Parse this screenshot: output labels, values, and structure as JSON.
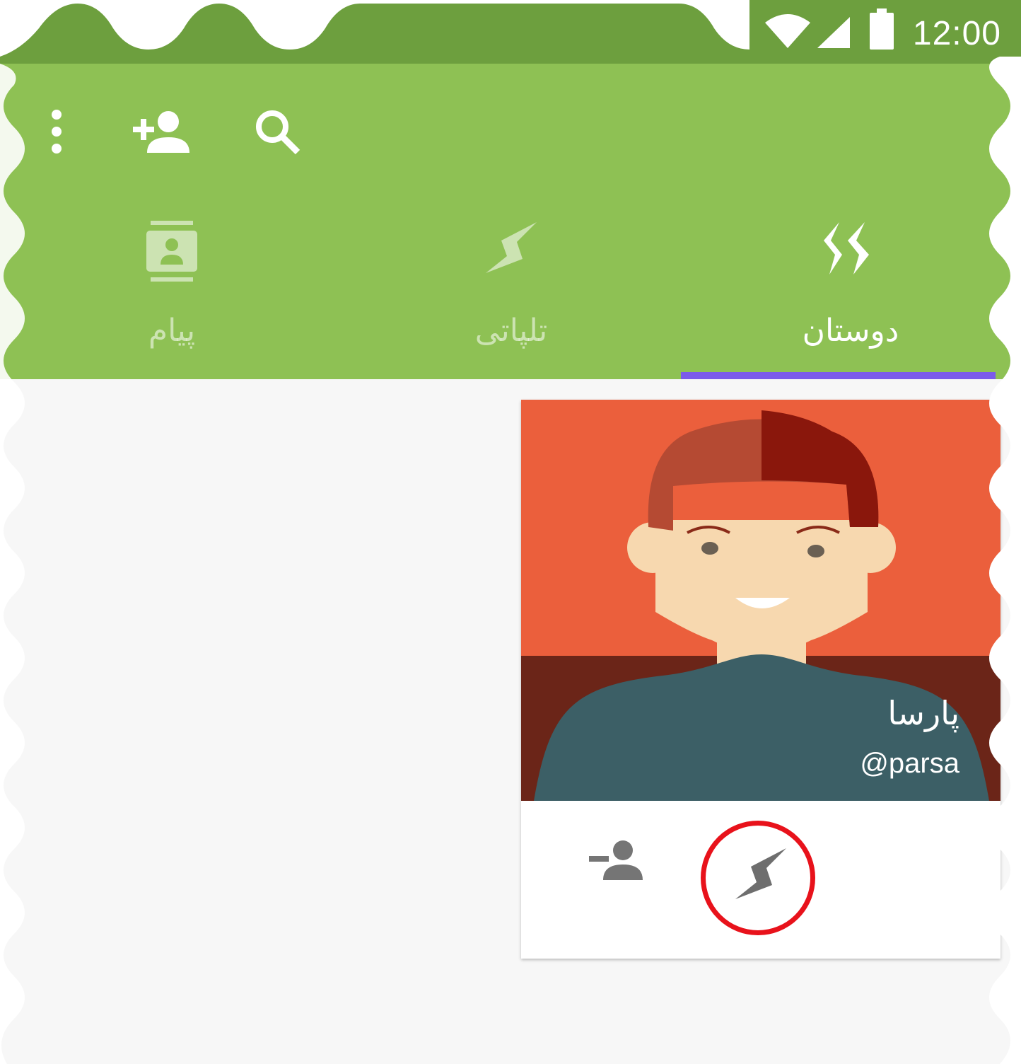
{
  "status_bar": {
    "time": "12:00",
    "icons": [
      "wifi-icon",
      "cellular-signal-icon",
      "battery-icon"
    ]
  },
  "toolbar": {
    "actions": [
      "more-options-icon",
      "add-friend-icon",
      "search-icon"
    ]
  },
  "tabs": [
    {
      "label": "پیام",
      "icon": "contact-card-icon",
      "selected": false
    },
    {
      "label": "تلپاتی",
      "icon": "lightning-icon",
      "selected": false
    },
    {
      "label": "دوستان",
      "icon": "double-lightning-icon",
      "selected": true
    }
  ],
  "friend_card": {
    "name": "پارسا",
    "username": "@parsa",
    "actions": [
      "remove-friend-icon",
      "telepathy-lightning-icon"
    ]
  },
  "colors": {
    "status_bar": "#6d9f3e",
    "app_bar": "#8ec154",
    "tab_indicator": "#7b5bea",
    "highlight_ring": "#e8121b",
    "background": "#f7f7f7",
    "action_icon": "#757575"
  }
}
